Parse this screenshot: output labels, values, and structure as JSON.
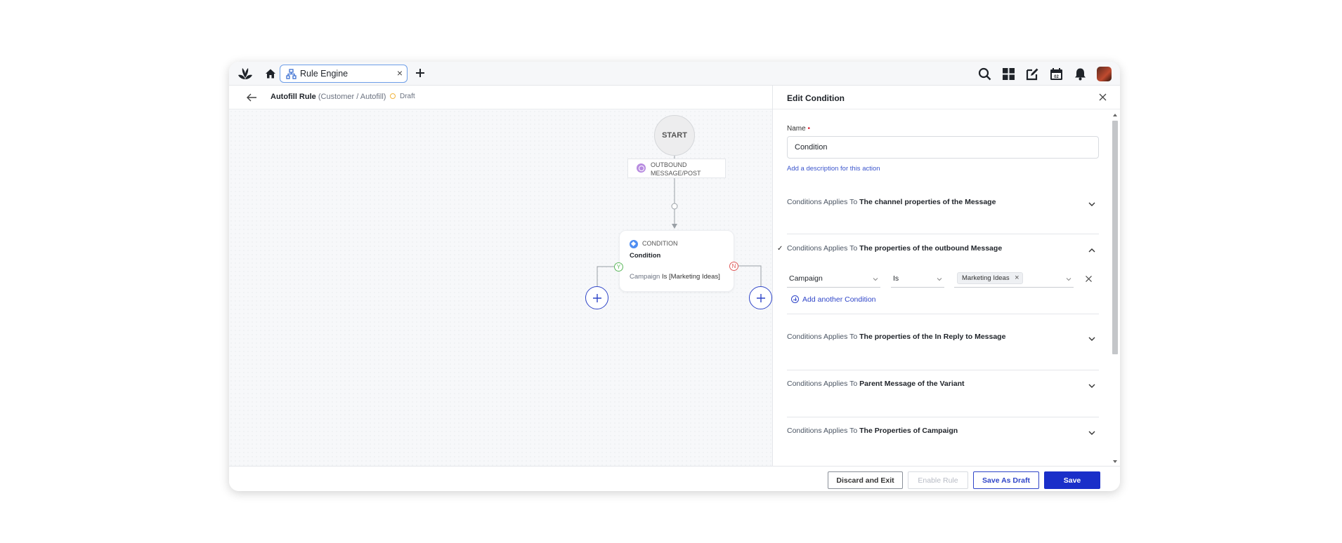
{
  "app": {
    "tab_label": "Rule Engine",
    "tab_close": "×"
  },
  "header": {
    "rule_name": "Autofill Rule",
    "rule_path": "(Customer / Autofill)",
    "status": "Draft"
  },
  "flow": {
    "start_label": "START",
    "trigger_label": "OUTBOUND MESSAGE/POST",
    "condition_type": "CONDITION",
    "condition_name": "Condition",
    "condition_field": "Campaign",
    "condition_summary": "Is [Marketing Ideas]",
    "yes_badge": "Y",
    "no_badge": "N"
  },
  "panel": {
    "title": "Edit Condition",
    "name_label": "Name",
    "required_mark": "•",
    "name_value": "Condition",
    "description_link": "Add a description for this action",
    "section_prefix": "Conditions Applies To",
    "sections": [
      {
        "target": "The channel properties of the Message"
      },
      {
        "target": "The properties of the outbound Message",
        "check": "✓"
      },
      {
        "target": "The properties of the In Reply to Message"
      },
      {
        "target": "Parent Message of the Variant"
      },
      {
        "target": "The Properties of Campaign"
      }
    ],
    "rule": {
      "field": "Campaign",
      "operator": "Is",
      "value_chip": "Marketing Ideas",
      "chip_remove": "×"
    },
    "add_condition": "Add another Condition"
  },
  "footer": {
    "discard": "Discard and Exit",
    "enable": "Enable Rule",
    "save_draft": "Save As Draft",
    "save": "Save"
  },
  "colors": {
    "primary": "#1a2fc9",
    "link": "#3b55cc",
    "draft": "#f1b43c",
    "yes": "#5cb85c",
    "no": "#e05a5a"
  }
}
